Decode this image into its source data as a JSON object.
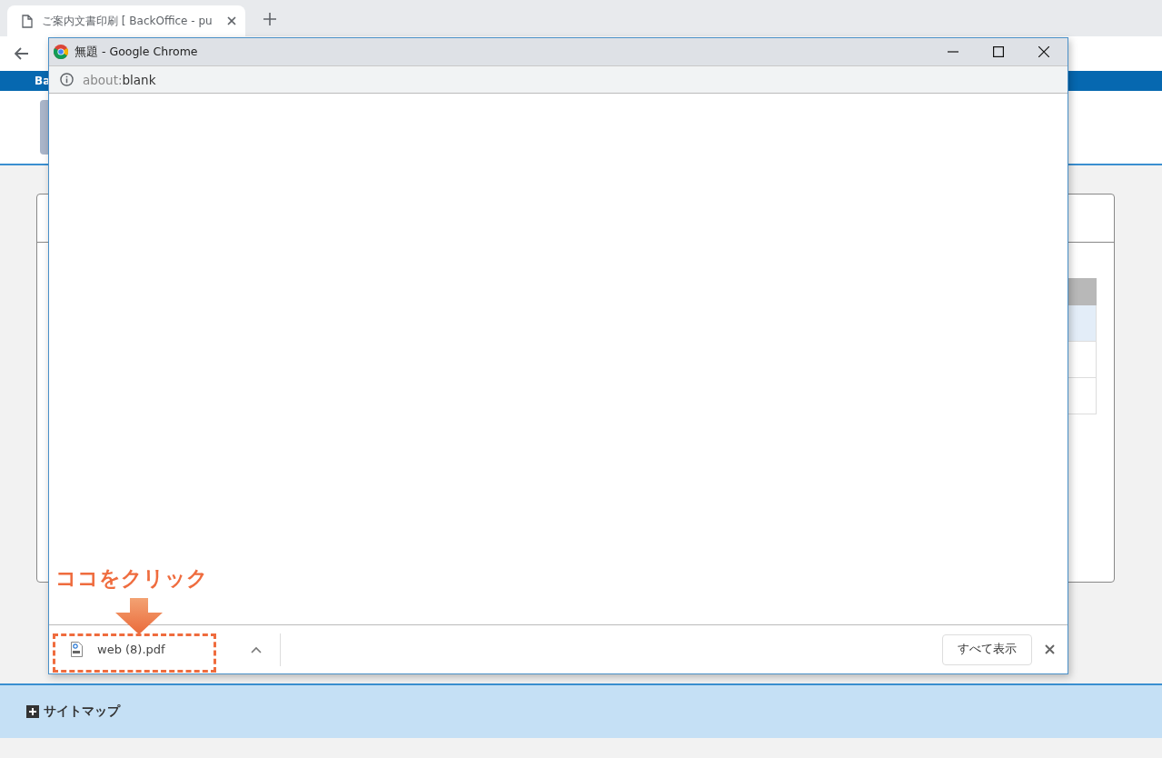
{
  "browser_tab": {
    "title": "ご案内文書印刷 [ BackOffice - pu"
  },
  "page": {
    "header_bar_text": "Ba",
    "footer_link": "サイトマップ"
  },
  "popup": {
    "title": "無題 - Google Chrome",
    "url_scheme": "about:",
    "url_rest": "blank",
    "download": {
      "filename": "web (8).pdf"
    },
    "show_all_button": "すべて表示"
  },
  "annotation": {
    "text": "ココをクリック"
  }
}
